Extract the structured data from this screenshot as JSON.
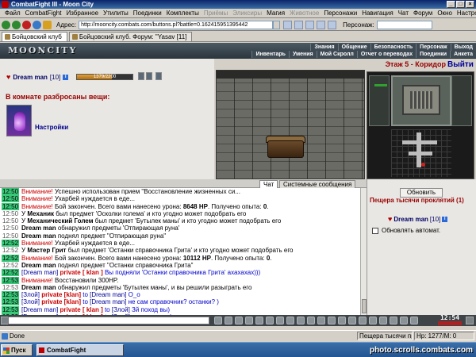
{
  "window": {
    "title": "CombatFight III - Moon City",
    "buttons": [
      "_",
      "□",
      "×"
    ]
  },
  "menu": {
    "items": [
      "Файл",
      "CombatFight",
      "Избранное",
      "Утилиты",
      "Поединки",
      "Комплекты",
      "Приёмы",
      "Эликсиры",
      "Магия",
      "Животное",
      "Персонажи",
      "Навигация",
      "Чат",
      "Форум",
      "Окно",
      "Настройки",
      "?"
    ]
  },
  "address": {
    "label": "Адрес:",
    "url": "http://mooncity.combats.com/buttons.pl?battle=0.162415951395442",
    "person_label": "Персонаж:",
    "person_value": ""
  },
  "tabs": [
    {
      "label": "Бойцовский клуб",
      "active": true
    },
    {
      "label": "Бойцовский клуб. Форум: \"Yasav [11]",
      "active": false
    }
  ],
  "game": {
    "logo": "MOONCITY",
    "nav_row1": [
      "Знания",
      "Общение",
      "Безопасность",
      "Персонаж",
      "Выход"
    ],
    "nav_row2": [
      "Инвентарь",
      "Умения",
      "Мой Скролл",
      "Отчет о переводах",
      "Поединки",
      "Анкета"
    ]
  },
  "player": {
    "name": "Dream man",
    "level": "[10]",
    "hp_text": "1379/2200",
    "hp_fraction": 0.63
  },
  "room": {
    "items_label": "В комнате разбросаны вещи:",
    "settings_link": "Настройки",
    "stage": "Этаж 5 - Коридор",
    "exit": "Выйти"
  },
  "chat_tabs": {
    "chat": "Чат",
    "system": "Системные сообщения"
  },
  "chat_lines": [
    {
      "ts": "12:50",
      "green": true,
      "parts": [
        {
          "t": "Внимание!",
          "c": "warn"
        },
        {
          "t": " Успешно использован прием \"Восстановление жизненных си...",
          "c": ""
        }
      ]
    },
    {
      "ts": "12:50",
      "green": true,
      "parts": [
        {
          "t": "Внимание!",
          "c": "warn"
        },
        {
          "t": " Ухарбей нуждается в еде...",
          "c": ""
        }
      ]
    },
    {
      "ts": "12:50",
      "green": true,
      "parts": [
        {
          "t": "Внимание!",
          "c": "warn"
        },
        {
          "t": " Бой закончен. Всего вами нанесено урона: ",
          "c": ""
        },
        {
          "t": "8648 HP",
          "c": "bold"
        },
        {
          "t": ". Получено опыта: ",
          "c": ""
        },
        {
          "t": "0",
          "c": "bold"
        },
        {
          "t": ".",
          "c": ""
        }
      ]
    },
    {
      "ts": "12:50",
      "green": false,
      "parts": [
        {
          "t": "У ",
          "c": ""
        },
        {
          "t": "Механик",
          "c": "bold"
        },
        {
          "t": " был предмет 'Осколки голема' и кто угодно может подобрать его",
          "c": ""
        }
      ]
    },
    {
      "ts": "12:50",
      "green": false,
      "parts": [
        {
          "t": "У ",
          "c": ""
        },
        {
          "t": "Механический Голем",
          "c": "bold"
        },
        {
          "t": " был предмет 'Бутылек маны' и кто угодно может подобрать его",
          "c": ""
        }
      ]
    },
    {
      "ts": "12:50",
      "green": false,
      "parts": [
        {
          "t": "Dream man",
          "c": "bold"
        },
        {
          "t": " обнаружил предметы 'Отпирающая руна'",
          "c": ""
        }
      ]
    },
    {
      "ts": "12:50",
      "green": false,
      "parts": [
        {
          "t": "Dream man",
          "c": "bold"
        },
        {
          "t": " поднял предмет \"Отпирающая руна\"",
          "c": ""
        }
      ]
    },
    {
      "ts": "12:52",
      "green": true,
      "parts": [
        {
          "t": "Внимание!",
          "c": "warn"
        },
        {
          "t": " Ухарбей нуждается в еде...",
          "c": ""
        }
      ]
    },
    {
      "ts": "12:52",
      "green": false,
      "parts": [
        {
          "t": "У ",
          "c": ""
        },
        {
          "t": "Мастер Грит",
          "c": "bold"
        },
        {
          "t": " был предмет 'Останки справочника Грита' и кто угодно может подобрать его",
          "c": ""
        }
      ]
    },
    {
      "ts": "12:52",
      "green": true,
      "parts": [
        {
          "t": "Внимание!",
          "c": "warn"
        },
        {
          "t": " Бой закончен. Всего вами нанесено урона: ",
          "c": ""
        },
        {
          "t": "10112 HP",
          "c": "bold"
        },
        {
          "t": ". Получено опыта: ",
          "c": ""
        },
        {
          "t": "0",
          "c": "bold"
        },
        {
          "t": ".",
          "c": ""
        }
      ]
    },
    {
      "ts": "12:52",
      "green": false,
      "parts": [
        {
          "t": "Dream man",
          "c": "bold"
        },
        {
          "t": " поднял предмет \"Останки справочника Грита\"",
          "c": ""
        }
      ]
    },
    {
      "ts": "12:52",
      "green": true,
      "parts": [
        {
          "t": "[Dream man]",
          "c": "blue"
        },
        {
          "t": " private [ klan ]",
          "c": "priv"
        },
        {
          "t": " Вы подняли 'Останки справочника Грита' ахахахах)))",
          "c": "pmsg"
        }
      ]
    },
    {
      "ts": "12:53",
      "green": true,
      "parts": [
        {
          "t": "Внимание!",
          "c": "warn"
        },
        {
          "t": " Восстановили 300HP.",
          "c": ""
        }
      ]
    },
    {
      "ts": "12:53",
      "green": false,
      "parts": [
        {
          "t": "Dream man",
          "c": "bold"
        },
        {
          "t": " обнаружил предметы 'Бутылек маны', и вы решили разыграть его",
          "c": ""
        }
      ]
    },
    {
      "ts": "12:53",
      "green": true,
      "parts": [
        {
          "t": "[Злой]",
          "c": "blue"
        },
        {
          "t": " private [klan]",
          "c": "priv"
        },
        {
          "t": " to ",
          "c": "pmsg"
        },
        {
          "t": "[Dream man]",
          "c": "blue"
        },
        {
          "t": " O_o",
          "c": "pmsg"
        }
      ]
    },
    {
      "ts": "12:53",
      "green": true,
      "parts": [
        {
          "t": "[Злой]",
          "c": "blue"
        },
        {
          "t": " private [klan]",
          "c": "priv"
        },
        {
          "t": " to ",
          "c": "pmsg"
        },
        {
          "t": "[Dream man]",
          "c": "blue"
        },
        {
          "t": " не сам справочник? останки? )",
          "c": "pmsg"
        }
      ]
    },
    {
      "ts": "12:53",
      "green": true,
      "parts": [
        {
          "t": "[Dream man]",
          "c": "blue"
        },
        {
          "t": " private [ klan ]",
          "c": "priv"
        },
        {
          "t": " to ",
          "c": "pmsg"
        },
        {
          "t": "[Злой]",
          "c": "blue"
        },
        {
          "t": " Зй поход вы)",
          "c": "pmsg"
        }
      ]
    },
    {
      "ts": "12:53",
      "green": true,
      "parts": [
        {
          "t": "[Dream man]",
          "c": "blue"
        },
        {
          "t": " private [ klan ]",
          "c": "priv"
        },
        {
          "t": " to ",
          "c": "pmsg"
        },
        {
          "t": "[Злой]",
          "c": "blue"
        },
        {
          "t": " это он и есть)",
          "c": "pmsg"
        }
      ]
    }
  ],
  "right_panel": {
    "refresh_button": "Обновить",
    "room_title": "Пещера тысячи проклятий (1)",
    "player_name": "Dream man",
    "player_level": "[10]",
    "auto_refresh_label": "Обновлять автомат.",
    "auto_refresh_checked": false
  },
  "clock": "12:54",
  "status": {
    "done": "Done",
    "zone": "Пещера тысячи проклятий",
    "hp": "Hp: 1277/M: 0"
  },
  "taskbar": {
    "start": "Пуск",
    "item": "CombatFight",
    "tray_text": "photo.scrolls.combats.com"
  },
  "colors": {
    "warning": "#cc0000",
    "private_label": "#cc0000",
    "private_text": "#0000cc",
    "timestamp_highlight": "#38c878",
    "room_title": "#990000"
  }
}
